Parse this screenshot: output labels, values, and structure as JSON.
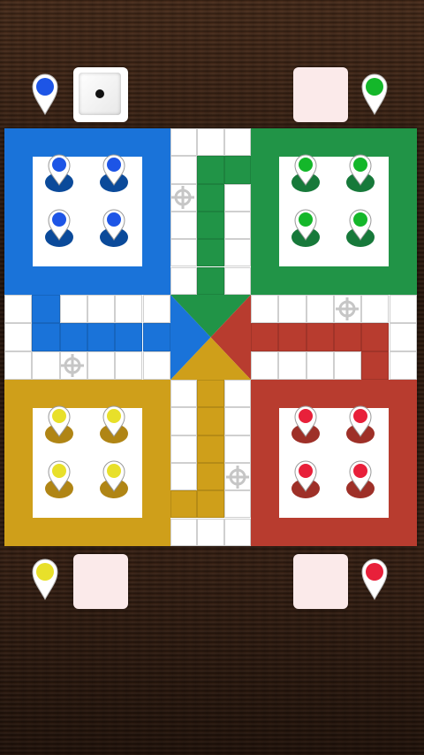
{
  "colors": {
    "blue": "#1a73d9",
    "green": "#219447",
    "red": "#b83c2f",
    "yellow": "#cf9f1a",
    "blue_dark": "#0b4a9a",
    "green_dark": "#17793a",
    "red_dark": "#9e3028",
    "yellow_dark": "#b08515",
    "blue_bright": "#1d55e6",
    "green_bright": "#14b72a",
    "red_bright": "#e8203a",
    "yellow_bright": "#e8e02a"
  },
  "players": [
    {
      "color": "blue",
      "dice_value": 1,
      "dice_active": true,
      "pieces_home": 4
    },
    {
      "color": "green",
      "dice_value": null,
      "dice_active": false,
      "pieces_home": 4
    },
    {
      "color": "yellow",
      "dice_value": null,
      "dice_active": false,
      "pieces_home": 4
    },
    {
      "color": "red",
      "dice_value": null,
      "dice_active": false,
      "pieces_home": 4
    }
  ],
  "icons": {
    "pin": "map-pin-icon",
    "safe_spot": "crosshair-star-icon",
    "dice": "dice-icon"
  }
}
